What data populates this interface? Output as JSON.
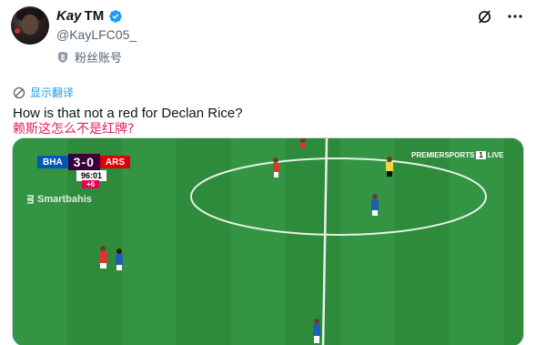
{
  "author": {
    "display_name": "Kay",
    "tm": "TM",
    "handle": "@KayLFC05_",
    "fan_label": "粉丝账号"
  },
  "translate_label": "显示翻译",
  "tweet": {
    "text": "How is that not a red for Declan Rice?",
    "translation": "赖斯这怎么不是红牌?"
  },
  "media": {
    "scorebug": {
      "home": "BHA",
      "score": "3-0",
      "away": "ARS",
      "clock": "96:01",
      "added_time": "+6"
    },
    "broadcaster": {
      "name": "PREMIERSPORTS",
      "channel": "1",
      "live": "LIVE"
    },
    "watermark": "Smartbahis"
  },
  "colors": {
    "link": "#1d9bf0",
    "translation": "#e0245e",
    "verified": "#1d9bf0",
    "pitch": "#2d8f3a"
  },
  "icons": [
    "verified-badge-icon",
    "grok-icon",
    "more-icon",
    "fan-account-icon",
    "translate-icon"
  ]
}
